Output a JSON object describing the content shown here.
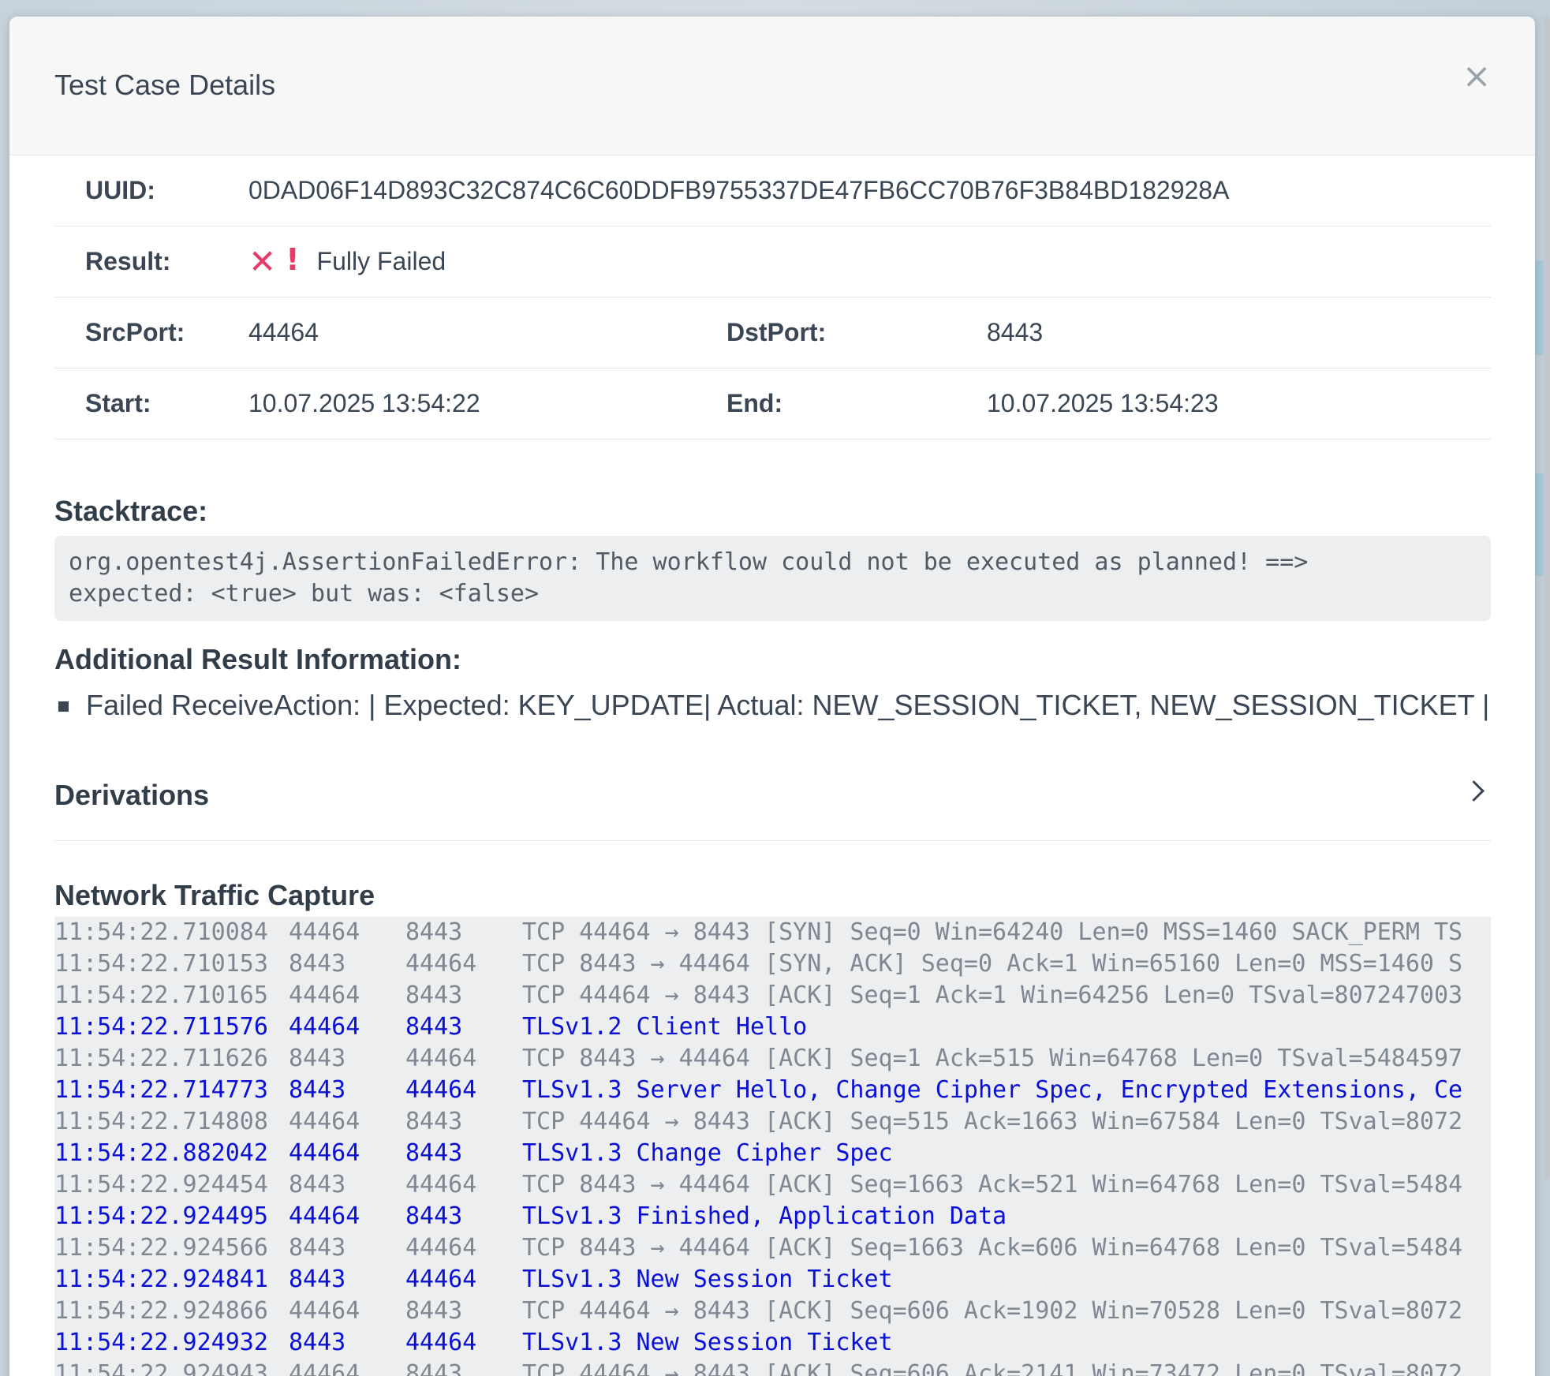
{
  "modal": {
    "title": "Test Case Details",
    "close_label": "×"
  },
  "details": {
    "uuid_label": "UUID:",
    "uuid_value": "0DAD06F14D893C32C874C6C60DDFB9755337DE47FB6CC70B76F3B84BD182928A",
    "result_label": "Result:",
    "result_icon_x": "✕",
    "result_icon_bang": "!",
    "result_value": "Fully Failed",
    "srcport_label": "SrcPort:",
    "srcport_value": "44464",
    "dstport_label": "DstPort:",
    "dstport_value": "8443",
    "start_label": "Start:",
    "start_value": "10.07.2025 13:54:22",
    "end_label": "End:",
    "end_value": "10.07.2025 13:54:23"
  },
  "stacktrace": {
    "title": "Stacktrace:",
    "text": "org.opentest4j.AssertionFailedError: The workflow could not be executed as planned! ==>\nexpected: <true> but was: <false>"
  },
  "additional": {
    "title": "Additional Result Information:",
    "items": [
      "Failed ReceiveAction: | Expected: KEY_UPDATE| Actual: NEW_SESSION_TICKET, NEW_SESSION_TICKET |"
    ]
  },
  "derivations": {
    "title": "Derivations"
  },
  "capture": {
    "title": "Network Traffic Capture",
    "packets": [
      {
        "time": "11:54:22.710084",
        "src": "44464",
        "dst": "8443",
        "info": "TCP 44464 → 8443 [SYN] Seq=0 Win=64240 Len=0 MSS=1460 SACK_PERM TS",
        "tls": false
      },
      {
        "time": "11:54:22.710153",
        "src": "8443",
        "dst": "44464",
        "info": "TCP 8443 → 44464 [SYN, ACK] Seq=0 Ack=1 Win=65160 Len=0 MSS=1460 S",
        "tls": false
      },
      {
        "time": "11:54:22.710165",
        "src": "44464",
        "dst": "8443",
        "info": "TCP 44464 → 8443 [ACK] Seq=1 Ack=1 Win=64256 Len=0 TSval=807247003",
        "tls": false
      },
      {
        "time": "11:54:22.711576",
        "src": "44464",
        "dst": "8443",
        "info": "TLSv1.2 Client Hello",
        "tls": true
      },
      {
        "time": "11:54:22.711626",
        "src": "8443",
        "dst": "44464",
        "info": "TCP 8443 → 44464 [ACK] Seq=1 Ack=515 Win=64768 Len=0 TSval=5484597",
        "tls": false
      },
      {
        "time": "11:54:22.714773",
        "src": "8443",
        "dst": "44464",
        "info": "TLSv1.3 Server Hello, Change Cipher Spec, Encrypted Extensions, Ce",
        "tls": true
      },
      {
        "time": "11:54:22.714808",
        "src": "44464",
        "dst": "8443",
        "info": "TCP 44464 → 8443 [ACK] Seq=515 Ack=1663 Win=67584 Len=0 TSval=8072",
        "tls": false
      },
      {
        "time": "11:54:22.882042",
        "src": "44464",
        "dst": "8443",
        "info": "TLSv1.3 Change Cipher Spec",
        "tls": true
      },
      {
        "time": "11:54:22.924454",
        "src": "8443",
        "dst": "44464",
        "info": "TCP 8443 → 44464 [ACK] Seq=1663 Ack=521 Win=64768 Len=0 TSval=5484",
        "tls": false
      },
      {
        "time": "11:54:22.924495",
        "src": "44464",
        "dst": "8443",
        "info": "TLSv1.3 Finished, Application Data",
        "tls": true
      },
      {
        "time": "11:54:22.924566",
        "src": "8443",
        "dst": "44464",
        "info": "TCP 8443 → 44464 [ACK] Seq=1663 Ack=606 Win=64768 Len=0 TSval=5484",
        "tls": false
      },
      {
        "time": "11:54:22.924841",
        "src": "8443",
        "dst": "44464",
        "info": "TLSv1.3 New Session Ticket",
        "tls": true
      },
      {
        "time": "11:54:22.924866",
        "src": "44464",
        "dst": "8443",
        "info": "TCP 44464 → 8443 [ACK] Seq=606 Ack=1902 Win=70528 Len=0 TSval=8072",
        "tls": false
      },
      {
        "time": "11:54:22.924932",
        "src": "8443",
        "dst": "44464",
        "info": "TLSv1.3 New Session Ticket",
        "tls": true
      },
      {
        "time": "11:54:22.924943",
        "src": "44464",
        "dst": "8443",
        "info": "TCP 44464 → 8443 [ACK] Seq=606 Ack=2141 Win=73472 Len=0 TSval=8072",
        "tls": false
      }
    ]
  },
  "colors": {
    "tls_text": "#0b10d6",
    "tcp_text": "#7f8892",
    "failed_icon": "#e8396a"
  }
}
